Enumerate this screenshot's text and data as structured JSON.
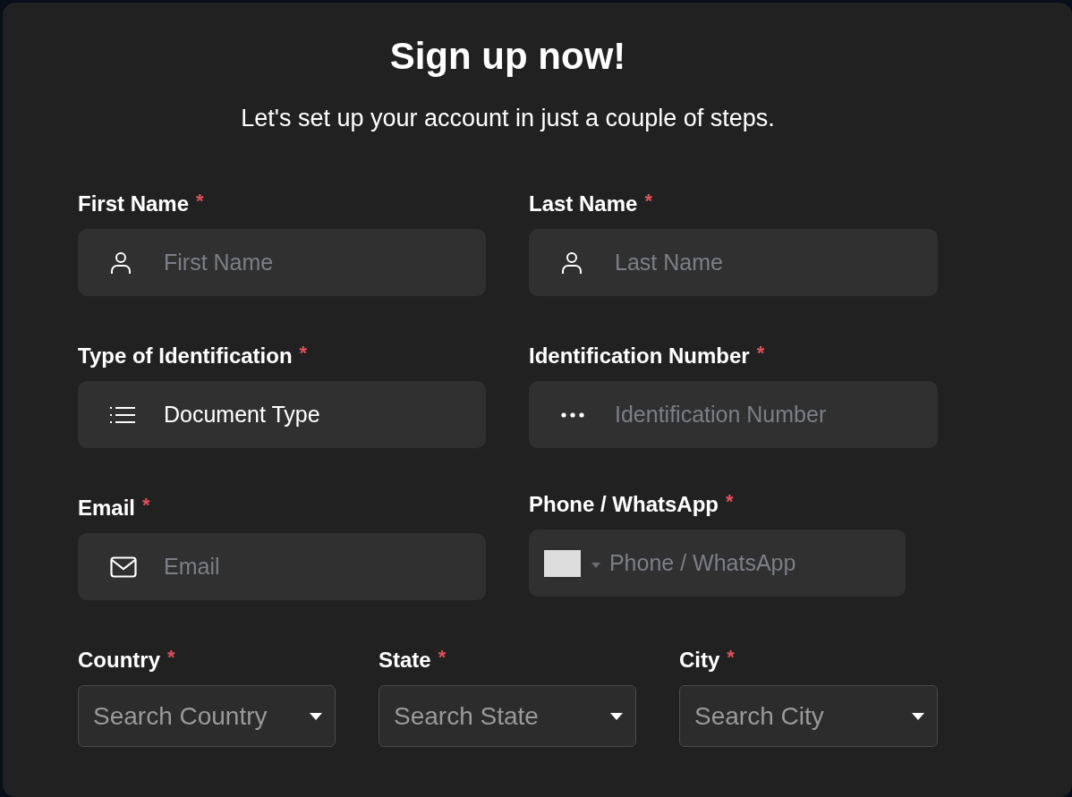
{
  "title": "Sign up now!",
  "subtitle": "Let's set up your account in just a couple of steps.",
  "rows": [
    {
      "fields": [
        {
          "label": "First Name",
          "required_mark": "*",
          "kind": "name",
          "placeholder": "First Name"
        },
        {
          "label": "Last Name",
          "required_mark": "*",
          "kind": "name",
          "placeholder": "Last Name"
        }
      ]
    },
    {
      "fields": [
        {
          "label": "Type of Identification",
          "required_mark": "*",
          "kind": "document",
          "value": "Document Type"
        },
        {
          "label": "Identification Number",
          "required_mark": "*",
          "kind": "number",
          "placeholder": "Identification Number"
        }
      ]
    },
    {
      "fields": [
        {
          "label": "Email",
          "required_mark": "*",
          "kind": "email",
          "placeholder": "Email"
        },
        {
          "label": "Phone / WhatsApp",
          "required_mark": "*",
          "kind": "phone",
          "placeholder": "Phone / WhatsApp"
        }
      ]
    },
    {
      "fields": [
        {
          "label": "Country",
          "required_mark": "*",
          "kind": "dropdown",
          "placeholder": "Search Country"
        },
        {
          "label": "State",
          "required_mark": "*",
          "kind": "dropdown",
          "placeholder": "Search State"
        },
        {
          "label": "City",
          "required_mark": "*",
          "kind": "dropdown",
          "placeholder": "Search City"
        }
      ]
    }
  ]
}
